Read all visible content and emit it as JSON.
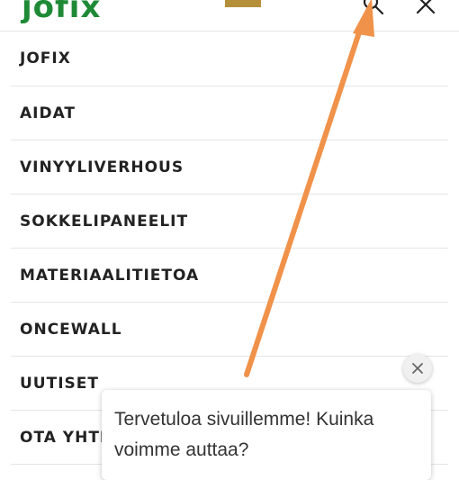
{
  "header": {
    "logo_text": "jofix",
    "search_icon": "search-icon",
    "close_icon": "close-icon"
  },
  "menu": {
    "items": [
      {
        "label": "JOFIX"
      },
      {
        "label": "AIDAT"
      },
      {
        "label": "VINYYLIVERHOUS"
      },
      {
        "label": "SOKKELIPANEELIT"
      },
      {
        "label": "MATERIAALITIETOA"
      },
      {
        "label": "ONCEWALL"
      },
      {
        "label": "UUTISET"
      },
      {
        "label": "OTA YHTEYTTÄ"
      }
    ]
  },
  "chat": {
    "message": "Tervetuloa sivuillemme! Kuinka voimme auttaa?",
    "close_icon": "close-icon"
  },
  "colors": {
    "logo_green": "#1f8a36",
    "logo_bar": "#b68f3b",
    "arrow": "#f0924a",
    "menu_text": "#222222"
  }
}
